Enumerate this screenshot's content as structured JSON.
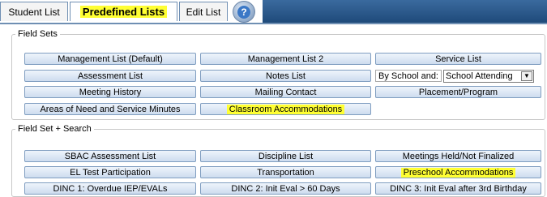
{
  "tabs": [
    {
      "label": "Student List",
      "active": false
    },
    {
      "label": "Predefined Lists",
      "active": true
    },
    {
      "label": "Edit List",
      "active": false
    }
  ],
  "help": {
    "glyph": "?",
    "icon": "help-icon"
  },
  "field_sets": {
    "legend": "Field Sets",
    "buttons": [
      "Management List (Default)",
      "Management List 2",
      "Service List",
      "Assessment List",
      "Notes List",
      "Meeting History",
      "Mailing Contact",
      "Placement/Program",
      "Areas of Need and Service Minutes",
      "Classroom Accommodations"
    ],
    "school_label": "By School and:",
    "school_select": "School Attending"
  },
  "field_set_search": {
    "legend": "Field Set + Search",
    "buttons": [
      "SBAC Assessment List",
      "Discipline List",
      "Meetings Held/Not Finalized",
      "EL Test Participation",
      "Transportation",
      "Preschool Accommodations",
      "DINC 1: Overdue IEP/EVALs",
      "DINC 2: Init Eval > 60 Days",
      "DINC 3: Init Eval after 3rd Birthday"
    ]
  },
  "highlight_color": "#ffff33",
  "header_color": "#1f4a7a"
}
